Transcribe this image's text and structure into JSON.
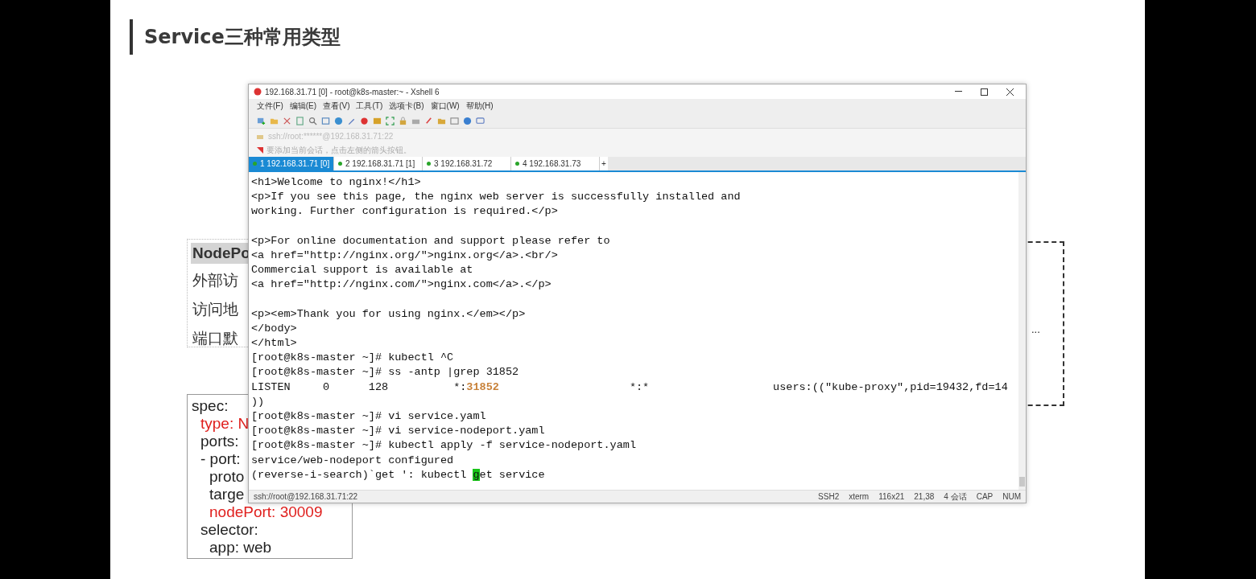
{
  "slide": {
    "title": "Service三种常用类型",
    "notes": [
      {
        "text": "NodePo",
        "highlighted": true
      },
      {
        "text": "外部访",
        "highlighted": false
      },
      {
        "text": "访问地",
        "highlighted": false
      },
      {
        "text": "端口默",
        "highlighted": false
      }
    ],
    "code": [
      {
        "text": "spec:",
        "highlighted": false,
        "children": [
          {
            "text": "type: N",
            "highlighted": true
          },
          {
            "text": "ports:",
            "highlighted": false
          },
          {
            "text": "- port:",
            "highlighted": false,
            "children": [
              {
                "text": "proto",
                "highlighted": false
              },
              {
                "text": "targe",
                "highlighted": false
              },
              {
                "text": "nodePort: 30009",
                "highlighted": true
              }
            ]
          },
          {
            "text": "selector:",
            "highlighted": false,
            "children": [
              {
                "text": "app: web",
                "highlighted": false
              }
            ]
          }
        ]
      }
    ],
    "diagram_text": "..."
  },
  "window": {
    "title": "192.168.31.71 [0] - root@k8s-master:~ - Xshell 6",
    "menu": [
      "文件(F)",
      "编辑(E)",
      "查看(V)",
      "工具(T)",
      "选项卡(B)",
      "窗口(W)",
      "帮助(H)"
    ],
    "address": "ssh://root:******@192.168.31.71:22",
    "hint": "要添加当前会话，点击左侧的箭头按钮。",
    "tabs": [
      {
        "label": "1 192.168.31.71 [0]",
        "selected": true
      },
      {
        "label": "2 192.168.31.71 [1]",
        "selected": false
      },
      {
        "label": "3 192.168.31.72",
        "selected": false
      },
      {
        "label": "4 192.168.31.73",
        "selected": false
      }
    ],
    "new_tab": "+",
    "terminal": [
      {
        "kind": "text",
        "parts": [
          {
            "text": "<h1>Welcome to nginx!</h1>",
            "kind": "plain"
          }
        ]
      },
      {
        "kind": "text",
        "parts": [
          {
            "text": "<p>If you see this page, the nginx web server is successfully installed and",
            "kind": "plain"
          }
        ]
      },
      {
        "kind": "text",
        "parts": [
          {
            "text": "working. Further configuration is required.</p>",
            "kind": "plain"
          }
        ]
      },
      {
        "kind": "blank"
      },
      {
        "kind": "text",
        "parts": [
          {
            "text": "<p>For online documentation and support please refer to",
            "kind": "plain"
          }
        ]
      },
      {
        "kind": "text",
        "parts": [
          {
            "text": "<a href=\"http://nginx.org/\">nginx.org</a>.<br/>",
            "kind": "plain"
          }
        ]
      },
      {
        "kind": "text",
        "parts": [
          {
            "text": "Commercial support is available at",
            "kind": "plain"
          }
        ]
      },
      {
        "kind": "text",
        "parts": [
          {
            "text": "<a href=\"http://nginx.com/\">nginx.com</a>.</p>",
            "kind": "plain"
          }
        ]
      },
      {
        "kind": "blank"
      },
      {
        "kind": "text",
        "parts": [
          {
            "text": "<p><em>Thank you for using nginx.</em></p>",
            "kind": "plain"
          }
        ]
      },
      {
        "kind": "text",
        "parts": [
          {
            "text": "</body>",
            "kind": "plain"
          }
        ]
      },
      {
        "kind": "text",
        "parts": [
          {
            "text": "</html>",
            "kind": "plain"
          }
        ]
      },
      {
        "kind": "text",
        "parts": [
          {
            "text": "[root@k8s-master ~]# kubectl ^C",
            "kind": "plain"
          }
        ]
      },
      {
        "kind": "text",
        "parts": [
          {
            "text": "[root@k8s-master ~]# ss -antp |grep 31852",
            "kind": "plain"
          }
        ]
      },
      {
        "kind": "text",
        "parts": [
          {
            "text": "LISTEN     0      128          *:",
            "kind": "plain"
          },
          {
            "text": "31852",
            "kind": "port"
          },
          {
            "text": "                    *:*                   users:((\"kube-proxy\",pid=19432,fd=14",
            "kind": "plain"
          }
        ]
      },
      {
        "kind": "text",
        "parts": [
          {
            "text": "))",
            "kind": "plain"
          }
        ]
      },
      {
        "kind": "text",
        "parts": [
          {
            "text": "[root@k8s-master ~]# vi service.yaml",
            "kind": "plain"
          }
        ]
      },
      {
        "kind": "text",
        "parts": [
          {
            "text": "[root@k8s-master ~]# vi service-nodeport.yaml",
            "kind": "plain"
          }
        ]
      },
      {
        "kind": "text",
        "parts": [
          {
            "text": "[root@k8s-master ~]# kubectl apply -f service-nodeport.yaml",
            "kind": "plain"
          }
        ]
      },
      {
        "kind": "text",
        "parts": [
          {
            "text": "service/web-nodeport configured",
            "kind": "plain"
          }
        ]
      },
      {
        "kind": "text",
        "parts": [
          {
            "text": "(reverse-i-search)`get ': kubectl ",
            "kind": "plain"
          },
          {
            "text": "g",
            "kind": "cursor"
          },
          {
            "text": "et service",
            "kind": "plain"
          }
        ]
      }
    ],
    "status_bar": {
      "connection": "ssh://root@192.168.31.71:22",
      "items": [
        "SSH2",
        "xterm",
        "116x21",
        "21,38",
        "4 会话",
        "CAP",
        "NUM"
      ]
    }
  }
}
